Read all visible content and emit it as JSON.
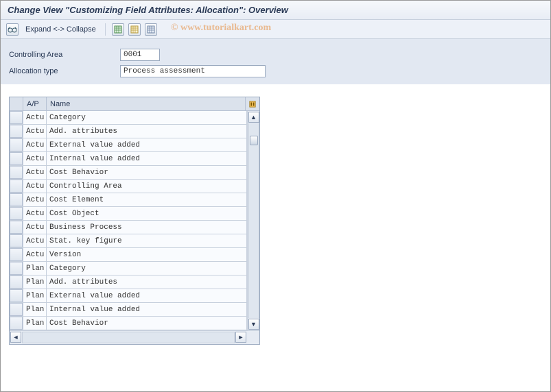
{
  "title": "Change View \"Customizing Field Attributes: Allocation\": Overview",
  "toolbar": {
    "expand_collapse": "Expand <-> Collapse"
  },
  "watermark": "© www.tutorialkart.com",
  "form": {
    "controlling_area_label": "Controlling Area",
    "controlling_area_value": "0001",
    "allocation_type_label": "Allocation type",
    "allocation_type_value": "Process assessment"
  },
  "table": {
    "headers": {
      "ap": "A/P",
      "name": "Name"
    },
    "rows": [
      {
        "ap": "Actu",
        "name": "Category"
      },
      {
        "ap": "Actu",
        "name": "Add. attributes"
      },
      {
        "ap": "Actu",
        "name": "External value added"
      },
      {
        "ap": "Actu",
        "name": "Internal value added"
      },
      {
        "ap": "Actu",
        "name": "Cost Behavior"
      },
      {
        "ap": "Actu",
        "name": "Controlling Area"
      },
      {
        "ap": "Actu",
        "name": "Cost Element"
      },
      {
        "ap": "Actu",
        "name": "Cost Object"
      },
      {
        "ap": "Actu",
        "name": "Business Process"
      },
      {
        "ap": "Actu",
        "name": "Stat. key figure"
      },
      {
        "ap": "Actu",
        "name": "Version"
      },
      {
        "ap": "Plan",
        "name": "Category"
      },
      {
        "ap": "Plan",
        "name": "Add. attributes"
      },
      {
        "ap": "Plan",
        "name": "External value added"
      },
      {
        "ap": "Plan",
        "name": "Internal value added"
      },
      {
        "ap": "Plan",
        "name": "Cost Behavior"
      }
    ]
  }
}
